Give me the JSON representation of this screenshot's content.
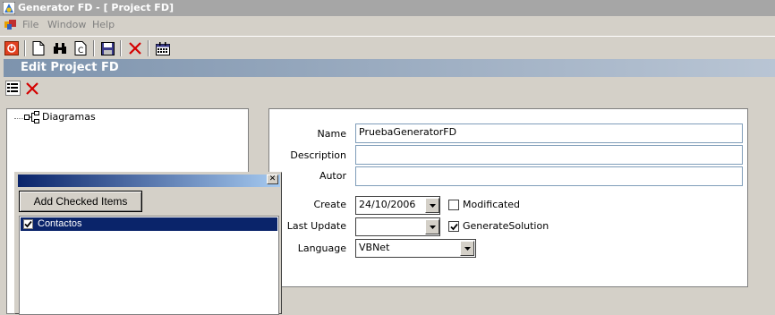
{
  "window": {
    "title": "Generator FD - [ Project FD]"
  },
  "menu": {
    "items": [
      "File",
      "Window",
      "Help"
    ]
  },
  "child": {
    "title": "Edit Project FD"
  },
  "tree": {
    "root": "Diagramas"
  },
  "popup": {
    "add_button": "Add Checked Items",
    "items": [
      {
        "label": "Contactos",
        "checked": true,
        "selected": true
      }
    ]
  },
  "form": {
    "name_label": "Name",
    "name_value": "PruebaGeneratorFD",
    "description_label": "Description",
    "description_value": "",
    "autor_label": "Autor",
    "autor_value": "",
    "create_label": "Create",
    "create_value": "24/10/2006",
    "modificated_label": "Modificated",
    "modificated_checked": false,
    "lastupdate_label": "Last Update",
    "lastupdate_value": "",
    "generate_label": "GenerateSolution",
    "generate_checked": true,
    "language_label": "Language",
    "language_value": "VBNet"
  },
  "colors": {
    "selection": "#0a246a",
    "close_red": "#d40000"
  }
}
